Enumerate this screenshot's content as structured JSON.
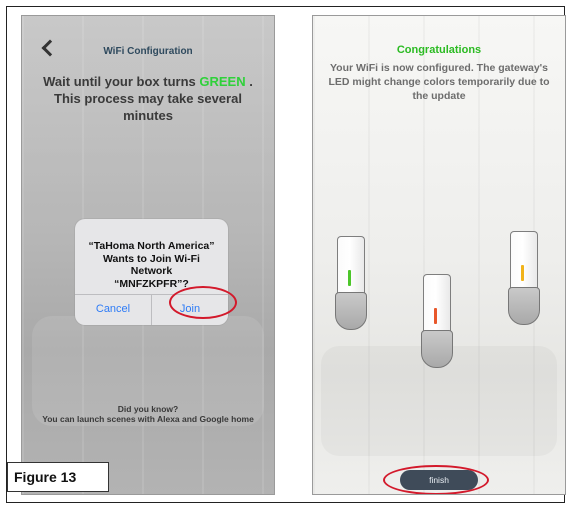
{
  "left_screen": {
    "title": "WiFi Configuration",
    "message_prefix": "Wait until your box turns",
    "message_highlight": "GREEN",
    "message_suffix": ". This process may take several minutes",
    "dialog": {
      "line1": "“TaHoma North America”",
      "line2": "Wants to Join Wi-Fi Network",
      "line3": "“MNFZKPFR”?",
      "cancel_label": "Cancel",
      "join_label": "Join"
    },
    "tip_line1": "Did you know?",
    "tip_line2": "You can launch scenes with Alexa and Google home"
  },
  "right_screen": {
    "title": "Congratulations",
    "message": "Your WiFi is now configured. The gateway's LED might change colors temporarily due to the update",
    "finish_label": "finish",
    "gateways": [
      {
        "led_color": "#4cc62a"
      },
      {
        "led_color": "#e8572a"
      },
      {
        "led_color": "#f1b31a"
      }
    ]
  },
  "figure_caption": "Figure 13",
  "colors": {
    "highlight_green": "#2fd13a",
    "annotation_red": "#d3192b",
    "dialog_button_blue": "#2f7cf6",
    "finish_button_bg": "#3f4b59"
  }
}
